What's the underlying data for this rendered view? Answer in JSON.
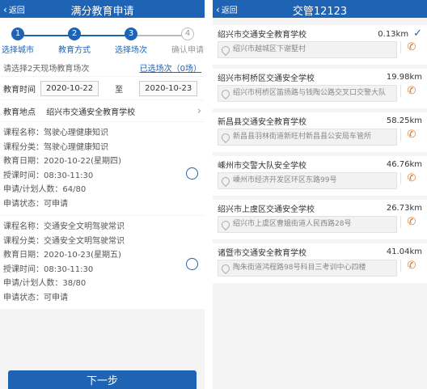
{
  "left": {
    "back": "返回",
    "title": "满分教育申请",
    "steps": [
      {
        "num": "1",
        "label": "选择城市",
        "active": true
      },
      {
        "num": "2",
        "label": "教育方式",
        "active": true
      },
      {
        "num": "3",
        "label": "选择场次",
        "active": true
      },
      {
        "num": "4",
        "label": "确认申请",
        "active": false
      }
    ],
    "select_prompt": "请选择2天现场教育场次",
    "selected_link": "已选场次（0场）",
    "date_label": "教育时间",
    "date_from": "2020-10-22",
    "date_sep": "至",
    "date_to": "2020-10-23",
    "place_label": "教育地点",
    "place_value": "绍兴市交通安全教育学校",
    "courses": [
      {
        "name": "课程名称：驾驶心理健康知识",
        "category": "课程分类：驾驶心理健康知识",
        "date": "教育日期：2020-10-22(星期四)",
        "time": "授课时间：08:30-11:30",
        "count": "申请/计划人数：64/80",
        "status": "申请状态：可申请"
      },
      {
        "name": "课程名称：交通安全文明驾驶常识",
        "category": "课程分类：交通安全文明驾驶常识",
        "date": "教育日期：2020-10-23(星期五)",
        "time": "授课时间：08:30-11:30",
        "count": "申请/计划人数：38/80",
        "status": "申请状态：可申请"
      }
    ],
    "next_button": "下一步"
  },
  "right": {
    "back": "返回",
    "title": "交管12123",
    "schools": [
      {
        "name": "绍兴市交通安全教育学校",
        "distance": "0.13km",
        "address": "绍兴市越城区下谢墅村",
        "selected": true
      },
      {
        "name": "绍兴市柯桥区交通安全学校",
        "distance": "19.98km",
        "address": "绍兴市柯桥区笛扬路与钱陶公路交叉口交警大队",
        "selected": false
      },
      {
        "name": "新昌县交通安全教育学校",
        "distance": "58.25km",
        "address": "新昌县羽林街道新旺村新昌县公安局车管所",
        "selected": false
      },
      {
        "name": "嵊州市交警大队安全学校",
        "distance": "46.76km",
        "address": "嵊州市经济开发区环区东路99号",
        "selected": false
      },
      {
        "name": "绍兴市上虞区交通安全学校",
        "distance": "26.73km",
        "address": "绍兴市上虞区曹娥街道人民西路28号",
        "selected": false
      },
      {
        "name": "诸暨市交通安全教育学校",
        "distance": "41.04km",
        "address": "陶朱街道鸿程路98号科目三考训中心四楼",
        "selected": false
      }
    ]
  },
  "colors": {
    "primary": "#1f63b4",
    "phone": "#e07a2e"
  },
  "icons": {
    "back": "chevron-left-icon",
    "location": "location-pin-icon",
    "phone": "phone-icon",
    "selected": "checkmark-icon"
  }
}
